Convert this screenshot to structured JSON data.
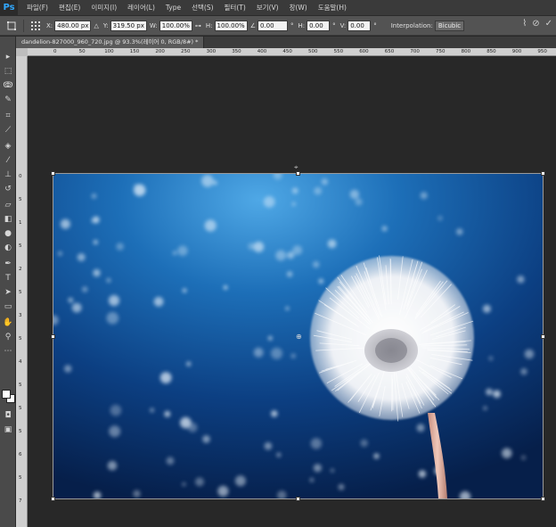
{
  "app": {
    "logo": "Ps"
  },
  "menu": [
    {
      "label": "파일(F)"
    },
    {
      "label": "편집(E)"
    },
    {
      "label": "이미지(I)"
    },
    {
      "label": "레이어(L)"
    },
    {
      "label": "Type"
    },
    {
      "label": "선택(S)"
    },
    {
      "label": "필터(T)"
    },
    {
      "label": "보기(V)"
    },
    {
      "label": "창(W)"
    },
    {
      "label": "도움말(H)"
    }
  ],
  "options": {
    "x_label": "X:",
    "x_value": "480.00 px",
    "y_label": "Y:",
    "y_value": "319.50 px",
    "w_label": "W:",
    "w_value": "100.00%",
    "h_label": "H:",
    "h_value": "100.00%",
    "angle_value": "0.00",
    "hskew_label": "H:",
    "hskew_value": "0.00",
    "vskew_label": "V:",
    "vskew_value": "0.00",
    "deg": "°",
    "interp_label": "Interpolation:",
    "interp_value": "Bicubic"
  },
  "document": {
    "tab_title": "dandelion-827000_960_720.jpg @ 93.3%(레이어 0, RGB/8#) *"
  },
  "ruler": {
    "h_ticks": [
      "0",
      "50",
      "100",
      "150",
      "200",
      "250",
      "300",
      "350",
      "400",
      "450",
      "500",
      "550",
      "600",
      "650",
      "700",
      "750",
      "800",
      "850",
      "900",
      "950"
    ],
    "v_ticks": [
      "0",
      "5",
      "1",
      "5",
      "2",
      "5",
      "3",
      "5",
      "4",
      "5",
      "5",
      "5",
      "6",
      "5",
      "7"
    ]
  },
  "colors": {
    "foreground": "#ffffff",
    "background": "#ffffff",
    "accent": "#31a8ff"
  },
  "toolbar_icons": [
    "move-icon",
    "marquee-icon",
    "lasso-icon",
    "quick-select-icon",
    "crop-icon",
    "eyedropper-icon",
    "healing-icon",
    "brush-icon",
    "stamp-icon",
    "history-brush-icon",
    "eraser-icon",
    "gradient-icon",
    "blur-icon",
    "dodge-icon",
    "pen-icon",
    "type-icon",
    "path-select-icon",
    "shape-icon",
    "hand-icon",
    "zoom-icon"
  ]
}
